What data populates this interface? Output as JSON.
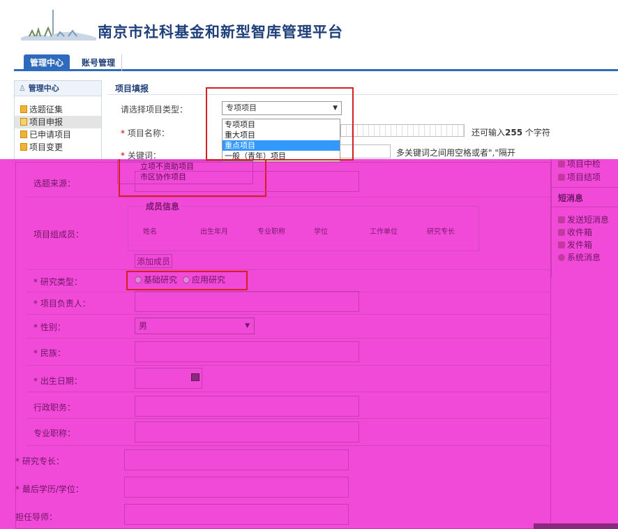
{
  "header": {
    "title": "南京市社科基金和新型智库管理平台"
  },
  "nav": {
    "tab_active": "管理中心",
    "tab_other": "账号管理"
  },
  "sidebar": {
    "heading": "管理中心",
    "items": [
      {
        "label": "选题征集"
      },
      {
        "label": "项目申报"
      },
      {
        "label": "已申请项目"
      },
      {
        "label": "项目变更"
      }
    ]
  },
  "form": {
    "section_title": "项目填报",
    "type_label": "请选择项目类型：",
    "type_selected": "专项项目",
    "type_options": [
      "专项项目",
      "重大项目",
      "重点项目",
      "一般（青年）项目"
    ],
    "type_options_more": [
      "立项不资助项目",
      "市区协作项目"
    ],
    "name_label": "项目名称：",
    "name_hint_pre": "还可输入",
    "name_hint_num": "255",
    "name_hint_post": "个字符",
    "keywords_label": "关键词：",
    "keywords_hint": "多关键词之间用空格或者\",\"隔开",
    "source_label": "选题来源：",
    "members_label": "项目组成员：",
    "members_title": "成员信息",
    "member_columns": [
      "姓名",
      "出生年月",
      "专业职称",
      "学位",
      "工作单位",
      "研究专长"
    ],
    "add_member": "添加成员",
    "research_type_label": "研究类型：",
    "research_options": [
      "基础研究",
      "应用研究"
    ],
    "leader_label": "项目负责人：",
    "gender_label": "性别：",
    "gender_value": "男",
    "ethnicity_label": "民族：",
    "birth_label": "出生日期：",
    "admin_post_label": "行政职务：",
    "prof_title_label": "专业职称：",
    "specialty_label": "研究专长：",
    "degree_label": "最后学历/学位：",
    "mentor_label": "担任导师："
  },
  "right_panel": {
    "items_top": [
      "项目中检",
      "项目结项"
    ],
    "msg_heading": "短消息",
    "msg_items": [
      "发送短消息",
      "收件箱",
      "发件箱",
      "系统消息"
    ]
  },
  "colors": {
    "overlay": "#f24ad8",
    "brand": "#2e6bbd",
    "highlight": "#d42020"
  }
}
